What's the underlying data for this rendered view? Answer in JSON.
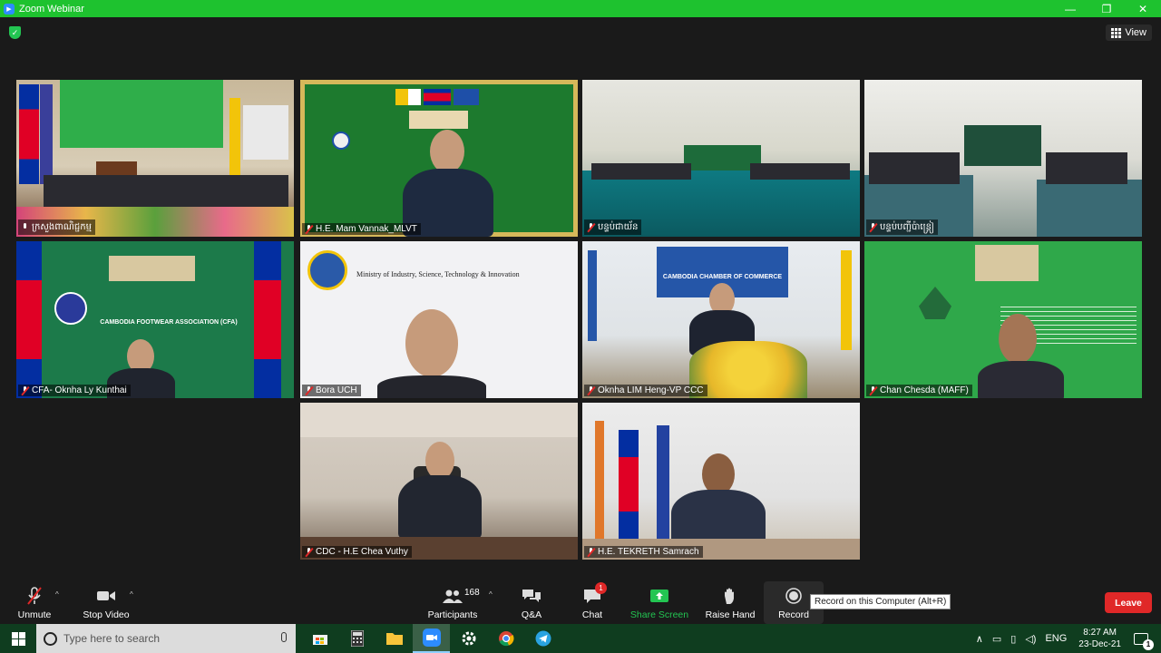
{
  "window": {
    "title": "Zoom Webinar",
    "controls": [
      "—",
      "❐",
      "✕"
    ]
  },
  "meeting": {
    "view_label": "View",
    "tiles": [
      {
        "name": "ក្រសួងពាណិជ្ជកម្ម",
        "mic": "on",
        "active": true
      },
      {
        "name": "H.E. Mam Vannak_MLVT",
        "mic": "off",
        "active": false
      },
      {
        "name": "បន្ទប់ជាយ័ន",
        "mic": "off",
        "active": false
      },
      {
        "name": "បន្ទប់បញ្ជីប៉ាន្ត្រៀ",
        "mic": "off",
        "active": false
      },
      {
        "name": "CFA- Oknha Ly Kunthai",
        "mic": "off",
        "active": false
      },
      {
        "name": "Bora UCH",
        "mic": "off",
        "active": false
      },
      {
        "name": "Oknha LIM Heng-VP CCC",
        "mic": "off",
        "active": false
      },
      {
        "name": "Chan Chesda (MAFF)",
        "mic": "off",
        "active": false
      },
      {
        "name": "CDC - H.E Chea Vuthy",
        "mic": "off",
        "active": false
      },
      {
        "name": "H.E. TEKRETH Samrach",
        "mic": "off",
        "active": false
      }
    ],
    "signs": {
      "ministry": "Ministry of Industry, Science, Technology & Innovation",
      "chamber": "CAMBODIA CHAMBER OF COMMERCE",
      "footwear": "CAMBODIA FOOTWEAR ASSOCIATION (CFA)"
    }
  },
  "toolbar": {
    "unmute": "Unmute",
    "stop_video": "Stop Video",
    "participants": "Participants",
    "participants_count": "168",
    "qa": "Q&A",
    "chat": "Chat",
    "chat_badge": "1",
    "share_screen": "Share Screen",
    "raise_hand": "Raise Hand",
    "record": "Record",
    "record_tooltip": "Record on this Computer (Alt+R)",
    "leave": "Leave"
  },
  "taskbar": {
    "search_placeholder": "Type here to search",
    "language": "ENG",
    "time": "8:27 AM",
    "date": "23-Dec-21",
    "notifications": "1"
  },
  "colors": {
    "titlebar": "#1ec22f",
    "active_speaker": "#f3d337",
    "leave": "#e02828",
    "share": "#23c552"
  }
}
